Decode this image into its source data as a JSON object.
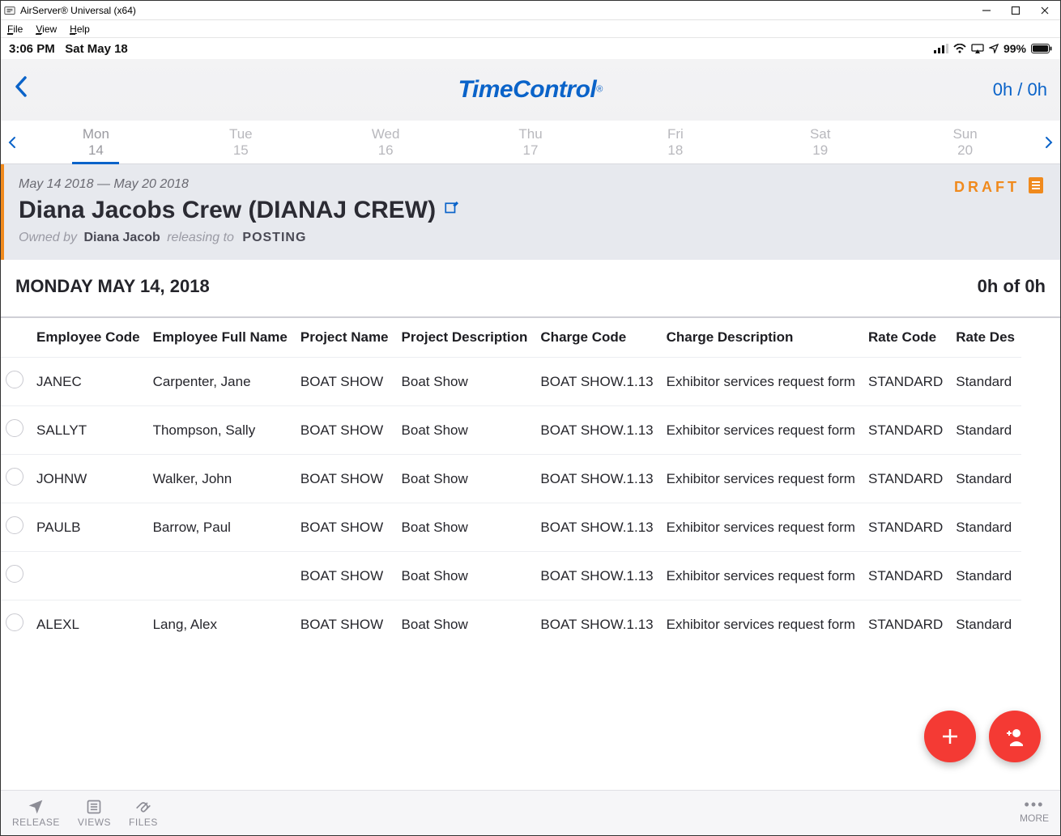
{
  "window": {
    "title": "AirServer® Universal (x64)"
  },
  "menubar": [
    "File",
    "View",
    "Help"
  ],
  "ios_status": {
    "time": "3:06 PM",
    "date": "Sat May 18",
    "battery": "99%"
  },
  "header": {
    "brand": "TimeControl",
    "hours_summary": "0h / 0h"
  },
  "week": {
    "days": [
      {
        "dow": "Mon",
        "num": "14",
        "selected": true
      },
      {
        "dow": "Tue",
        "num": "15"
      },
      {
        "dow": "Wed",
        "num": "16"
      },
      {
        "dow": "Thu",
        "num": "17"
      },
      {
        "dow": "Fri",
        "num": "18"
      },
      {
        "dow": "Sat",
        "num": "19"
      },
      {
        "dow": "Sun",
        "num": "20"
      }
    ]
  },
  "sheet": {
    "range": "May 14 2018 — May 20 2018",
    "title": "Diana Jacobs Crew (DIANAJ CREW)",
    "owned_by_label": "Owned by",
    "owner": "Diana Jacob",
    "releasing_label": "releasing to",
    "posting": "POSTING",
    "status": "DRAFT"
  },
  "day": {
    "heading": "MONDAY MAY 14, 2018",
    "hours": "0h of 0h"
  },
  "columns": [
    "Employee Code",
    "Employee Full Name",
    "Project Name",
    "Project Description",
    "Charge Code",
    "Charge Description",
    "Rate Code",
    "Rate Des"
  ],
  "rows": [
    {
      "emp_code": "JANEC",
      "emp_name": "Carpenter, Jane",
      "proj": "BOAT SHOW",
      "proj_desc": "Boat Show",
      "charge": "BOAT SHOW.1.13",
      "charge_desc": "Exhibitor services request form",
      "rate": "STANDARD",
      "rate_desc": "Standard"
    },
    {
      "emp_code": "SALLYT",
      "emp_name": "Thompson, Sally",
      "proj": "BOAT SHOW",
      "proj_desc": "Boat Show",
      "charge": "BOAT SHOW.1.13",
      "charge_desc": "Exhibitor services request form",
      "rate": "STANDARD",
      "rate_desc": "Standard"
    },
    {
      "emp_code": "JOHNW",
      "emp_name": "Walker, John",
      "proj": "BOAT SHOW",
      "proj_desc": "Boat Show",
      "charge": "BOAT SHOW.1.13",
      "charge_desc": "Exhibitor services request form",
      "rate": "STANDARD",
      "rate_desc": "Standard"
    },
    {
      "emp_code": "PAULB",
      "emp_name": "Barrow, Paul",
      "proj": "BOAT SHOW",
      "proj_desc": "Boat Show",
      "charge": "BOAT SHOW.1.13",
      "charge_desc": "Exhibitor services request form",
      "rate": "STANDARD",
      "rate_desc": "Standard"
    },
    {
      "emp_code": "",
      "emp_name": "",
      "proj": "BOAT SHOW",
      "proj_desc": "Boat Show",
      "charge": "BOAT SHOW.1.13",
      "charge_desc": "Exhibitor services request form",
      "rate": "STANDARD",
      "rate_desc": "Standard"
    },
    {
      "emp_code": "ALEXL",
      "emp_name": "Lang, Alex",
      "proj": "BOAT SHOW",
      "proj_desc": "Boat Show",
      "charge": "BOAT SHOW.1.13",
      "charge_desc": "Exhibitor services request form",
      "rate": "STANDARD",
      "rate_desc": "Standard"
    }
  ],
  "bottombar": {
    "release": "RELEASE",
    "views": "VIEWS",
    "files": "FILES",
    "more": "MORE"
  }
}
